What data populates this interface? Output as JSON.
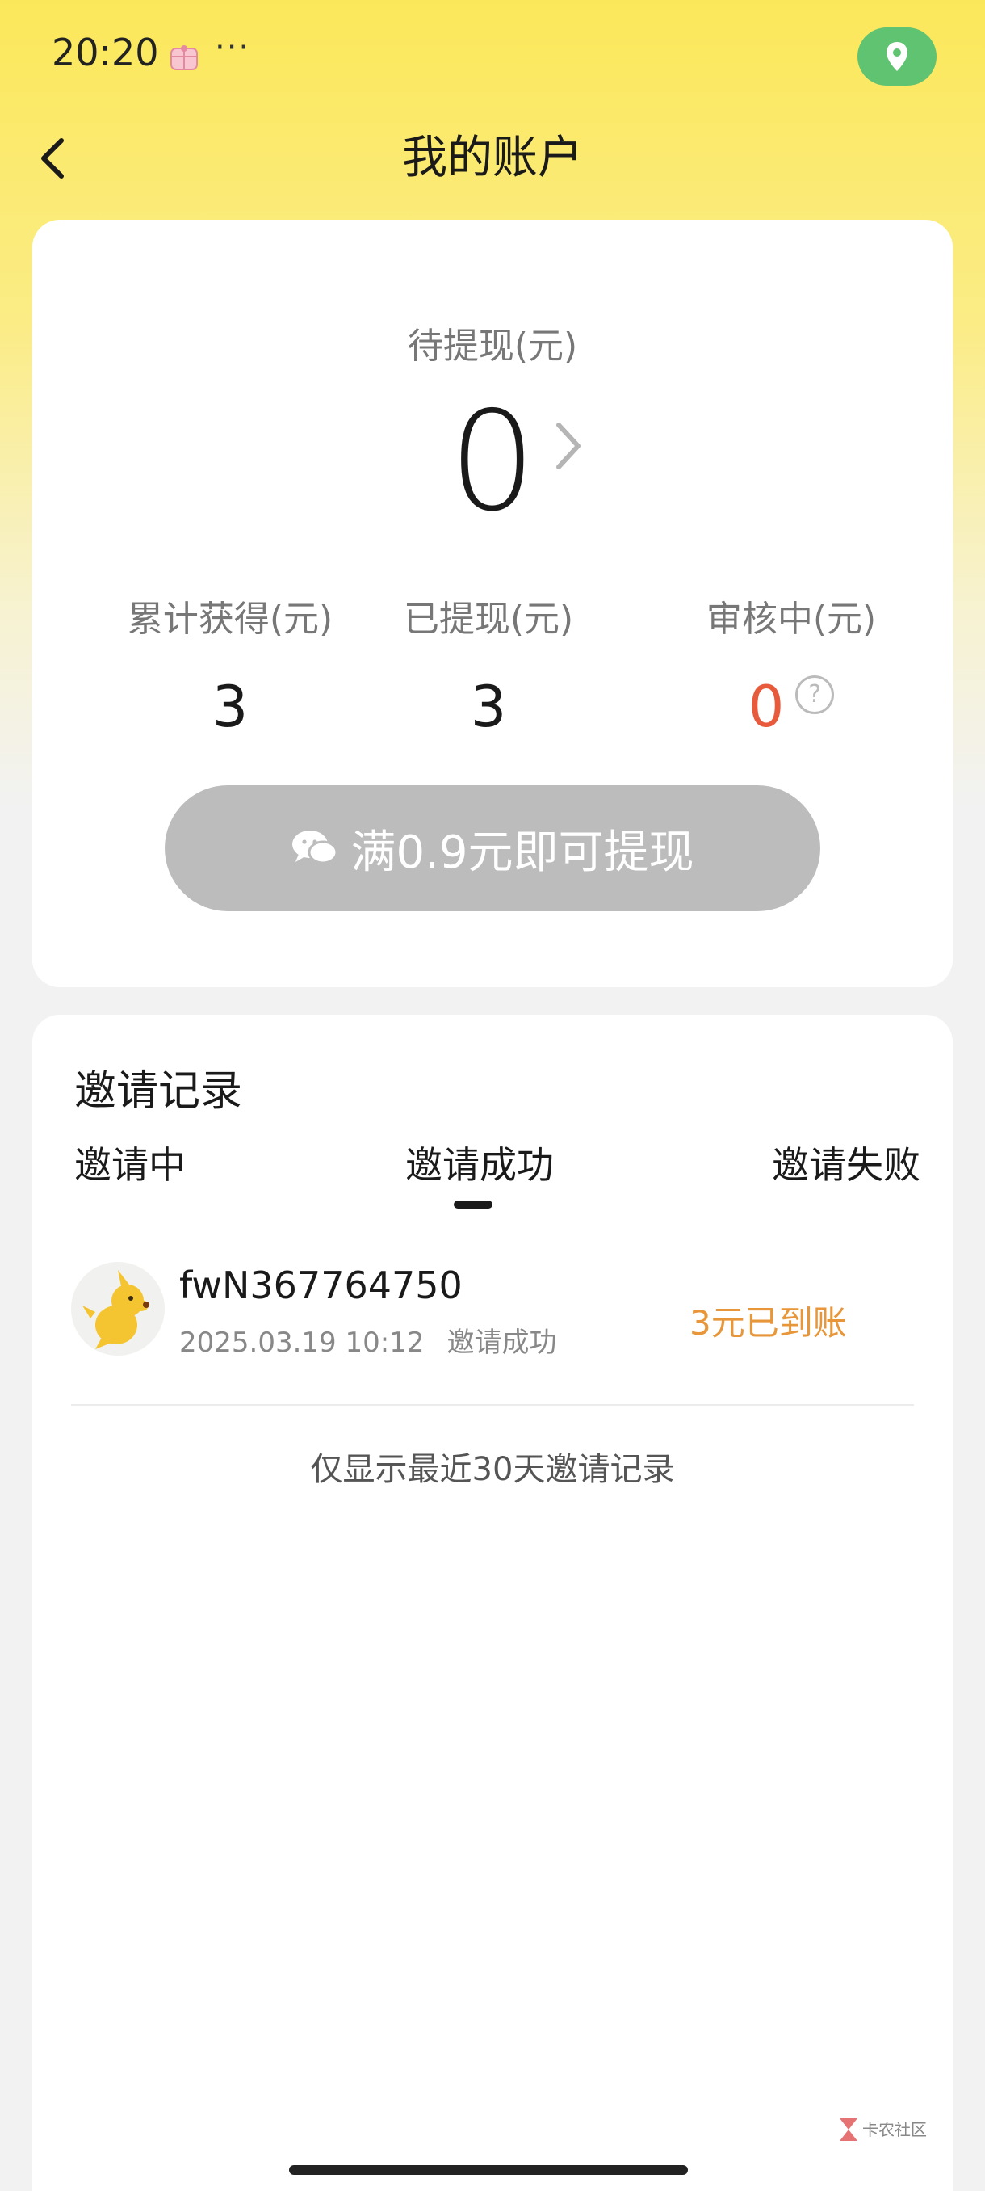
{
  "status_bar": {
    "time": "20:20",
    "dots": "···",
    "app_icon": "gift-box-icon",
    "location_icon": "location-pin-icon"
  },
  "nav": {
    "title": "我的账户",
    "back_icon": "chevron-left-icon"
  },
  "balance": {
    "pending_label": "待提现(元)",
    "pending_value": "0",
    "stats": [
      {
        "label": "累计获得(元)",
        "value": "3"
      },
      {
        "label": "已提现(元)",
        "value": "3"
      },
      {
        "label": "审核中(元)",
        "value": "0"
      }
    ],
    "help_glyph": "?",
    "withdraw_button": "满0.9元即可提现"
  },
  "invite": {
    "title": "邀请记录",
    "tabs": [
      "邀请中",
      "邀请成功",
      "邀请失败"
    ],
    "active_tab": 1,
    "records": [
      {
        "name": "fwN367764750",
        "date": "2025.03.19 10:12",
        "status": "邀请成功",
        "amount": "3元已到账"
      }
    ],
    "footnote": "仅显示最近30天邀请记录"
  },
  "watermark": {
    "text": "卡农社区"
  },
  "colors": {
    "accent_yellow": "#fbe85a",
    "review_red": "#e85a3c",
    "amount_orange": "#e8963a",
    "button_gray": "#bcbcbc",
    "location_green": "#5fc372"
  }
}
